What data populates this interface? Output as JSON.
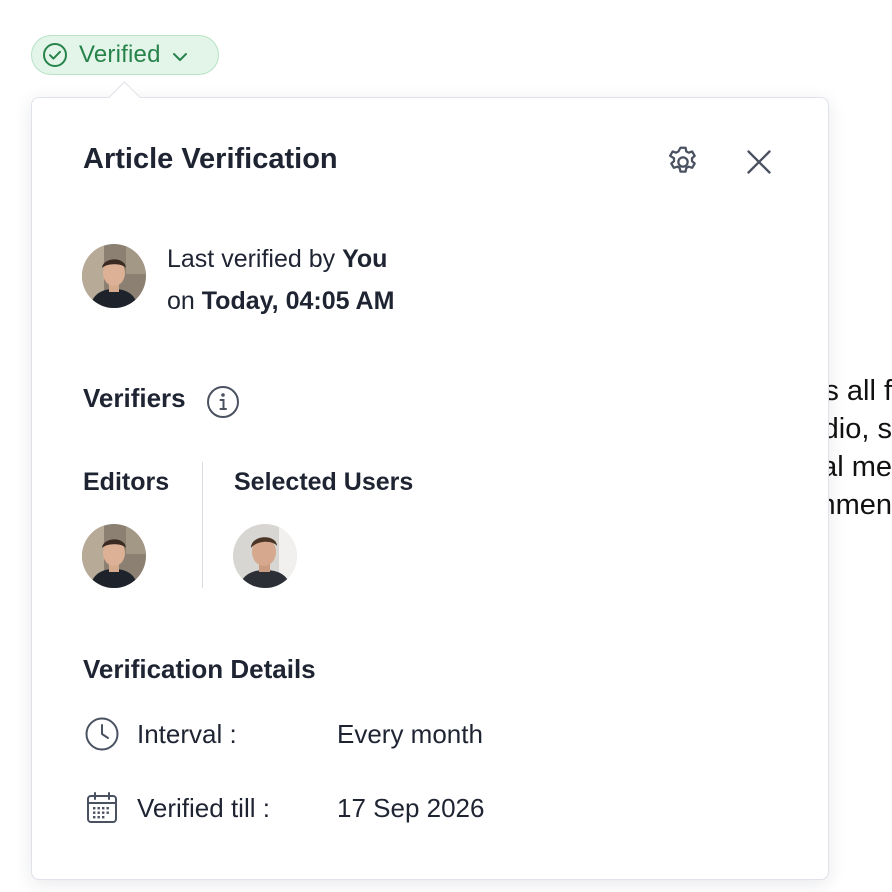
{
  "badge": {
    "label": "Verified",
    "accent_color": "#27834a",
    "background_color": "#e3f5e9",
    "icon": "check-circle-icon",
    "dropdown_icon": "chevron-down-icon"
  },
  "popover": {
    "title": "Article Verification",
    "settings_icon": "gear-icon",
    "close_icon": "close-icon"
  },
  "last_verified": {
    "prefix": "Last verified by",
    "user": "You",
    "on_prefix": "on",
    "datetime": "Today, 04:05 AM"
  },
  "verifiers": {
    "heading": "Verifiers",
    "info_icon": "info-icon",
    "editors_label": "Editors",
    "selected_users_label": "Selected Users"
  },
  "details": {
    "heading": "Verification Details",
    "rows": [
      {
        "icon": "clock-icon",
        "label": "Interval :",
        "value": "Every month"
      },
      {
        "icon": "calendar-icon",
        "label": "Verified till :",
        "value": "17 Sep 2026"
      }
    ]
  },
  "background_text": [
    "s all f",
    "dio, s",
    "al me",
    "nmen"
  ]
}
